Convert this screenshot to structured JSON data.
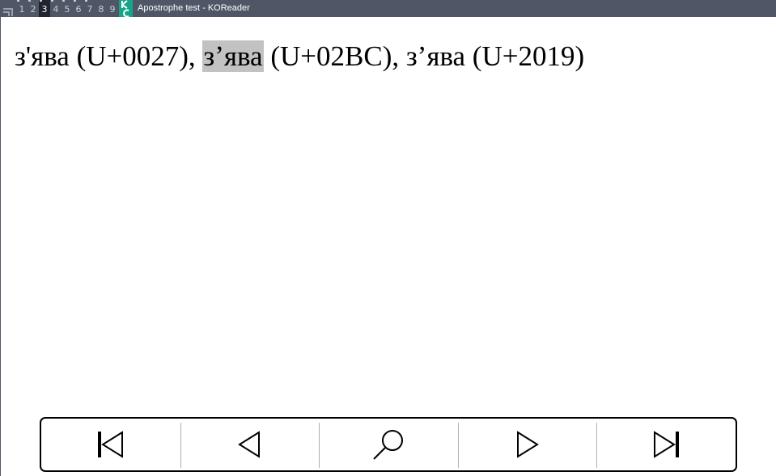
{
  "titlebar": {
    "workspaces": [
      "1",
      "2",
      "3",
      "4",
      "5",
      "6",
      "7",
      "8",
      "9"
    ],
    "active_workspace": "3",
    "window_title": "Apostrophe test - KOReader",
    "bar_color": "#4f5767",
    "app_icon_color": "#17a589"
  },
  "document": {
    "text_before": "з'ява (U+0027),",
    "highlighted": "зʼява",
    "text_after": "(U+02BC), з’ява (U+2019)",
    "highlight_color": "#c2c2c2"
  },
  "footer": {
    "buttons": [
      {
        "icon": "first-page-icon"
      },
      {
        "icon": "previous-icon"
      },
      {
        "icon": "search-icon"
      },
      {
        "icon": "next-icon"
      },
      {
        "icon": "last-page-icon"
      }
    ]
  }
}
